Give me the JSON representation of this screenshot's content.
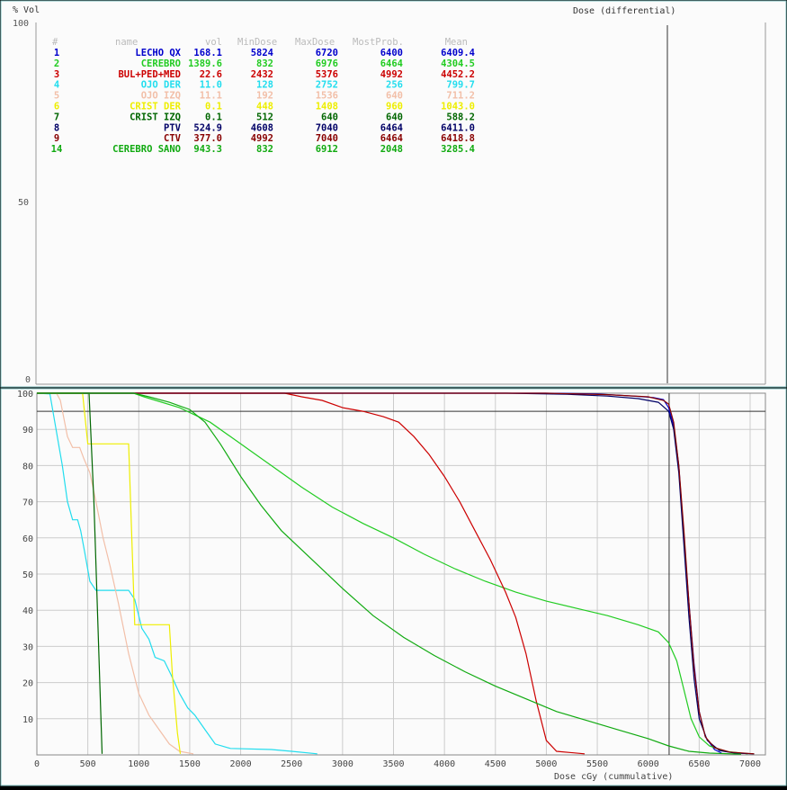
{
  "top_panel": {
    "ylabel": "% Vol",
    "title": "Dose (differential)",
    "yticks": [
      "100",
      "50",
      "0"
    ]
  },
  "structures_table": {
    "headers": [
      "#",
      "name",
      "vol",
      "MinDose",
      "MaxDose",
      "MostProb.",
      "Mean"
    ],
    "rows": [
      {
        "num": "1",
        "name": "LECHO QX",
        "vol": "168.1",
        "min": "5824",
        "max": "6720",
        "prob": "6400",
        "mean": "6409.4",
        "color": "#0000cc"
      },
      {
        "num": "2",
        "name": "CEREBRO",
        "vol": "1389.6",
        "min": "832",
        "max": "6976",
        "prob": "6464",
        "mean": "4304.5",
        "color": "#22cc22"
      },
      {
        "num": "3",
        "name": "BUL+PED+MED",
        "vol": "22.6",
        "min": "2432",
        "max": "5376",
        "prob": "4992",
        "mean": "4452.2",
        "color": "#cc0000"
      },
      {
        "num": "4",
        "name": "OJO DER",
        "vol": "11.0",
        "min": "128",
        "max": "2752",
        "prob": "256",
        "mean": "799.7",
        "color": "#22ddee"
      },
      {
        "num": "5",
        "name": "OJO IZQ",
        "vol": "11.1",
        "min": "192",
        "max": "1536",
        "prob": "640",
        "mean": "711.2",
        "color": "#f2bfa8"
      },
      {
        "num": "6",
        "name": "CRIST DER",
        "vol": "0.1",
        "min": "448",
        "max": "1408",
        "prob": "960",
        "mean": "1043.0",
        "color": "#eeee00"
      },
      {
        "num": "7",
        "name": "CRIST IZQ",
        "vol": "0.1",
        "min": "512",
        "max": "640",
        "prob": "640",
        "mean": "588.2",
        "color": "#006600"
      },
      {
        "num": "8",
        "name": "PTV",
        "vol": "524.9",
        "min": "4608",
        "max": "7040",
        "prob": "6464",
        "mean": "6411.0",
        "color": "#000066"
      },
      {
        "num": "9",
        "name": "CTV",
        "vol": "377.0",
        "min": "4992",
        "max": "7040",
        "prob": "6464",
        "mean": "6418.8",
        "color": "#880000"
      },
      {
        "num": "14",
        "name": "CEREBRO SANO",
        "vol": "943.3",
        "min": "832",
        "max": "6912",
        "prob": "2048",
        "mean": "3285.4",
        "color": "#11aa11"
      }
    ]
  },
  "chart_data": {
    "type": "line",
    "xlabel": "Dose cGy (cummulative)",
    "ylabel": "",
    "xlim": [
      0,
      7150
    ],
    "ylim": [
      0,
      100
    ],
    "xticks": [
      0,
      500,
      1000,
      1500,
      2000,
      2500,
      3000,
      3500,
      4000,
      4500,
      5000,
      5500,
      6000,
      6500,
      7000
    ],
    "yticks": [
      10,
      20,
      30,
      40,
      50,
      60,
      70,
      80,
      90,
      100
    ],
    "grid": true,
    "reference_lines": {
      "horizontal_y": 95,
      "vertical_x": 6205
    },
    "series": [
      {
        "name": "LECHO QX",
        "color": "#0000cc",
        "points": [
          [
            0,
            100
          ],
          [
            5000,
            100
          ],
          [
            5500,
            99.8
          ],
          [
            5800,
            99.3
          ],
          [
            6050,
            98.8
          ],
          [
            6150,
            98.2
          ],
          [
            6200,
            96
          ],
          [
            6250,
            91
          ],
          [
            6300,
            80
          ],
          [
            6350,
            60
          ],
          [
            6400,
            42
          ],
          [
            6450,
            25
          ],
          [
            6500,
            12
          ],
          [
            6560,
            5
          ],
          [
            6650,
            1.5
          ],
          [
            6720,
            0.5
          ]
        ]
      },
      {
        "name": "CEREBRO",
        "color": "#22cc22",
        "points": [
          [
            0,
            100
          ],
          [
            950,
            100
          ],
          [
            1050,
            99
          ],
          [
            1400,
            96
          ],
          [
            1700,
            92
          ],
          [
            2000,
            86
          ],
          [
            2300,
            80
          ],
          [
            2600,
            74
          ],
          [
            2900,
            68.5
          ],
          [
            3200,
            64
          ],
          [
            3500,
            60
          ],
          [
            3800,
            55.5
          ],
          [
            4100,
            51.5
          ],
          [
            4400,
            48
          ],
          [
            4700,
            45
          ],
          [
            5000,
            42.5
          ],
          [
            5300,
            40.5
          ],
          [
            5600,
            38.5
          ],
          [
            5900,
            36
          ],
          [
            6100,
            34
          ],
          [
            6200,
            31
          ],
          [
            6280,
            26
          ],
          [
            6350,
            18
          ],
          [
            6420,
            10
          ],
          [
            6500,
            5
          ],
          [
            6600,
            2.5
          ],
          [
            6750,
            1
          ],
          [
            6976,
            0.3
          ]
        ]
      },
      {
        "name": "BUL+PED+MED",
        "color": "#cc0000",
        "points": [
          [
            0,
            100
          ],
          [
            2432,
            100
          ],
          [
            2600,
            99
          ],
          [
            2800,
            98
          ],
          [
            3000,
            96
          ],
          [
            3200,
            95
          ],
          [
            3400,
            93.5
          ],
          [
            3550,
            92
          ],
          [
            3700,
            88
          ],
          [
            3850,
            83
          ],
          [
            4000,
            77
          ],
          [
            4150,
            70
          ],
          [
            4300,
            62
          ],
          [
            4450,
            54
          ],
          [
            4600,
            45
          ],
          [
            4700,
            38
          ],
          [
            4800,
            28
          ],
          [
            4900,
            15
          ],
          [
            5000,
            4
          ],
          [
            5100,
            1
          ],
          [
            5376,
            0.3
          ]
        ]
      },
      {
        "name": "OJO DER",
        "color": "#22ddee",
        "points": [
          [
            0,
            100
          ],
          [
            128,
            99.8
          ],
          [
            200,
            88
          ],
          [
            250,
            80
          ],
          [
            300,
            70
          ],
          [
            350,
            65
          ],
          [
            400,
            65
          ],
          [
            430,
            62
          ],
          [
            470,
            56
          ],
          [
            520,
            48
          ],
          [
            580,
            45.5
          ],
          [
            900,
            45.5
          ],
          [
            960,
            43
          ],
          [
            1030,
            35
          ],
          [
            1100,
            32
          ],
          [
            1160,
            27
          ],
          [
            1250,
            26
          ],
          [
            1320,
            22
          ],
          [
            1400,
            17
          ],
          [
            1480,
            13
          ],
          [
            1550,
            11
          ],
          [
            1650,
            7
          ],
          [
            1750,
            3
          ],
          [
            1900,
            1.8
          ],
          [
            2300,
            1.5
          ],
          [
            2500,
            1
          ],
          [
            2752,
            0.3
          ]
        ]
      },
      {
        "name": "OJO IZQ",
        "color": "#f2bfa8",
        "points": [
          [
            0,
            100
          ],
          [
            192,
            100
          ],
          [
            230,
            98
          ],
          [
            300,
            88
          ],
          [
            350,
            85
          ],
          [
            420,
            85
          ],
          [
            460,
            82
          ],
          [
            520,
            78
          ],
          [
            580,
            70
          ],
          [
            650,
            60
          ],
          [
            720,
            52
          ],
          [
            800,
            42
          ],
          [
            900,
            28
          ],
          [
            1000,
            17
          ],
          [
            1100,
            11
          ],
          [
            1200,
            7
          ],
          [
            1300,
            3
          ],
          [
            1400,
            1
          ],
          [
            1536,
            0.3
          ]
        ]
      },
      {
        "name": "CRIST DER",
        "color": "#eeee00",
        "points": [
          [
            0,
            100
          ],
          [
            448,
            100
          ],
          [
            500,
            86
          ],
          [
            900,
            86
          ],
          [
            930,
            61
          ],
          [
            960,
            36
          ],
          [
            1300,
            36
          ],
          [
            1330,
            22
          ],
          [
            1380,
            6
          ],
          [
            1408,
            0.3
          ]
        ]
      },
      {
        "name": "CRIST IZQ",
        "color": "#006600",
        "points": [
          [
            0,
            100
          ],
          [
            512,
            100
          ],
          [
            560,
            70
          ],
          [
            600,
            35
          ],
          [
            640,
            0.3
          ]
        ]
      },
      {
        "name": "PTV",
        "color": "#000066",
        "points": [
          [
            0,
            100
          ],
          [
            4608,
            100
          ],
          [
            5200,
            99.7
          ],
          [
            5600,
            99.2
          ],
          [
            5900,
            98.5
          ],
          [
            6100,
            97.5
          ],
          [
            6200,
            95
          ],
          [
            6250,
            90
          ],
          [
            6300,
            78
          ],
          [
            6350,
            58
          ],
          [
            6400,
            38
          ],
          [
            6450,
            21
          ],
          [
            6500,
            10
          ],
          [
            6580,
            4
          ],
          [
            6700,
            1.2
          ],
          [
            6850,
            0.5
          ],
          [
            7040,
            0.3
          ]
        ]
      },
      {
        "name": "CTV",
        "color": "#880000",
        "points": [
          [
            0,
            100
          ],
          [
            4992,
            100
          ],
          [
            5600,
            99.6
          ],
          [
            6000,
            99
          ],
          [
            6150,
            98
          ],
          [
            6200,
            97
          ],
          [
            6250,
            92
          ],
          [
            6300,
            80
          ],
          [
            6350,
            62
          ],
          [
            6400,
            42
          ],
          [
            6450,
            24
          ],
          [
            6500,
            12
          ],
          [
            6560,
            5
          ],
          [
            6650,
            2
          ],
          [
            6800,
            0.8
          ],
          [
            7040,
            0.3
          ]
        ]
      },
      {
        "name": "CEREBRO SANO",
        "color": "#11aa11",
        "points": [
          [
            0,
            100
          ],
          [
            950,
            100
          ],
          [
            1100,
            99
          ],
          [
            1300,
            97.5
          ],
          [
            1500,
            95.5
          ],
          [
            1650,
            92
          ],
          [
            1800,
            86
          ],
          [
            2000,
            77
          ],
          [
            2200,
            69
          ],
          [
            2400,
            62
          ],
          [
            2700,
            54
          ],
          [
            3000,
            46
          ],
          [
            3300,
            38.5
          ],
          [
            3600,
            32.5
          ],
          [
            3900,
            27.5
          ],
          [
            4200,
            23
          ],
          [
            4500,
            19
          ],
          [
            4800,
            15.5
          ],
          [
            5100,
            12
          ],
          [
            5400,
            9.5
          ],
          [
            5700,
            7
          ],
          [
            6000,
            4.5
          ],
          [
            6200,
            2.5
          ],
          [
            6400,
            1
          ],
          [
            6600,
            0.5
          ],
          [
            6912,
            0.2
          ]
        ]
      }
    ]
  }
}
